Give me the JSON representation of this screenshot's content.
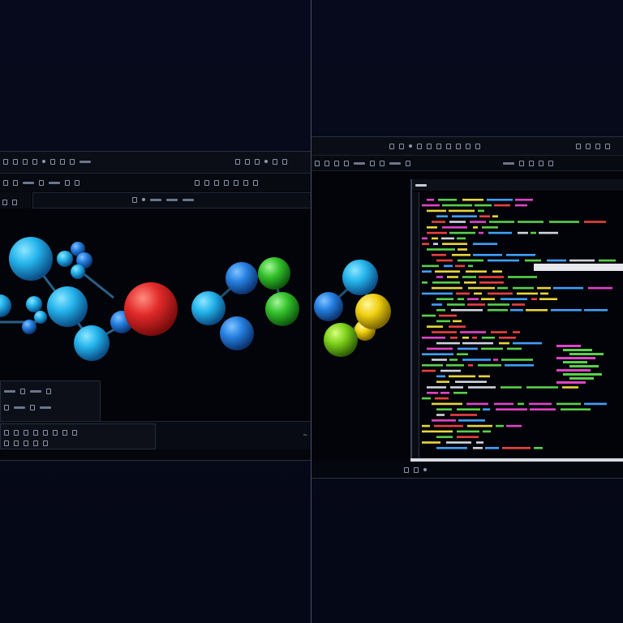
{
  "colors": {
    "background": "#070a1a",
    "atom_cyan": "#2fb6ec",
    "atom_blue": "#2a86e0",
    "atom_red": "#e23030",
    "atom_green": "#36c230",
    "atom_yellow": "#f0d010",
    "code_green": "#59d04a",
    "code_magenta": "#e044c8",
    "code_yellow": "#e8d63a",
    "code_red": "#e84040"
  },
  "left_window": {
    "icons": [
      "window-menu-icon",
      "toolbar-icon",
      "view-icon",
      "settings-icon"
    ],
    "footer_indicator": "~"
  },
  "right_window": {
    "icons": [
      "window-menu-icon",
      "toolbar-icon",
      "close-icon"
    ]
  }
}
